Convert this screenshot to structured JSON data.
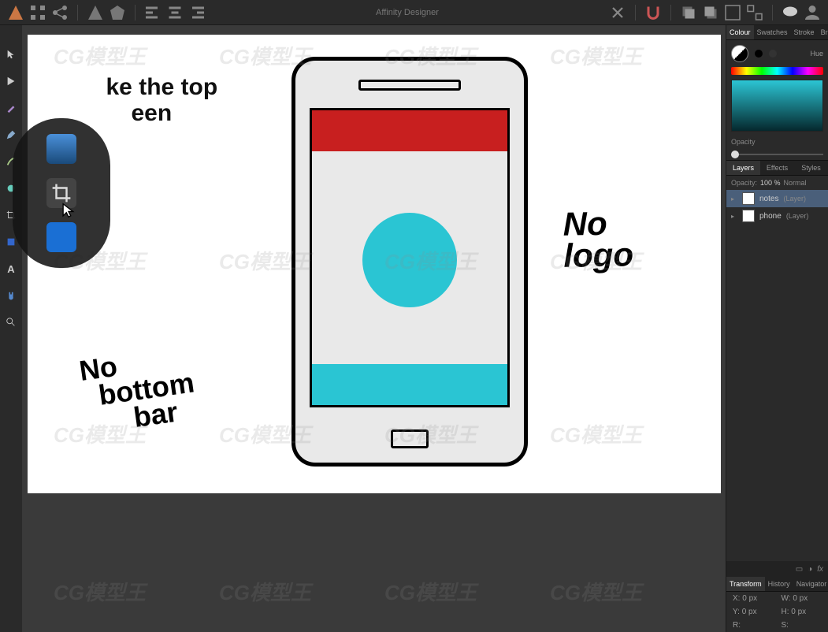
{
  "app": {
    "title": "Affinity Designer"
  },
  "color_tabs": [
    "Colour",
    "Swatches",
    "Stroke",
    "Brush"
  ],
  "hue_label": "Hue",
  "opacity_label": "Opacity",
  "layer_tabs": [
    "Layers",
    "Effects",
    "Styles"
  ],
  "layer_opacity_label": "Opacity:",
  "layer_opacity_value": "100 %",
  "layer_blend": "Normal",
  "layers": [
    {
      "name": "notes",
      "type": "(Layer)"
    },
    {
      "name": "phone",
      "type": "(Layer)"
    }
  ],
  "transform_tabs": [
    "Transform",
    "History",
    "Navigator"
  ],
  "transform": {
    "x_label": "X:",
    "x_val": "0 px",
    "w_label": "W:",
    "w_val": "0 px",
    "y_label": "Y:",
    "y_val": "0 px",
    "h_label": "H:",
    "h_val": "0 px",
    "r_label": "R:",
    "s_label": "S:"
  },
  "canvas": {
    "annotation_topleft_line1": "ke the top",
    "annotation_topleft_line2": "een",
    "annotation_nologo_1": "No",
    "annotation_nologo_2": "logo",
    "annotation_nobottom_1": "No",
    "annotation_nobottom_2": "bottom",
    "annotation_nobottom_3": "bar"
  },
  "watermark_text": "CG模型王"
}
